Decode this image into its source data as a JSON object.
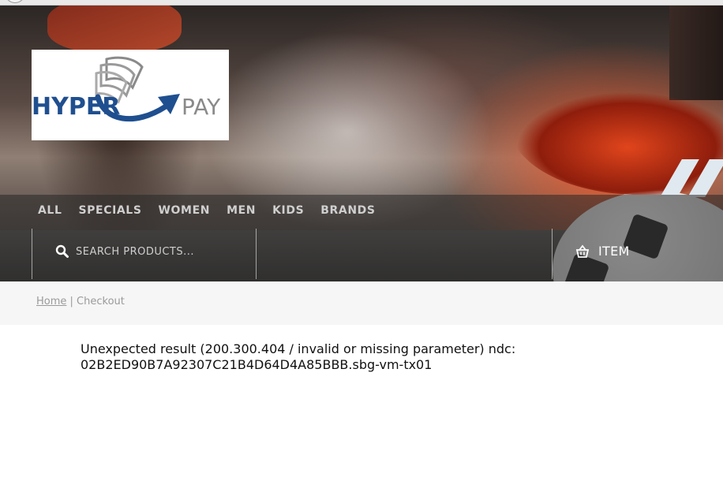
{
  "logo": {
    "text_left": "HYPER",
    "text_right": "PAY"
  },
  "nav": {
    "items": [
      "ALL",
      "SPECIALS",
      "WOMEN",
      "MEN",
      "KIDS",
      "BRANDS"
    ]
  },
  "search": {
    "placeholder": "SEARCH PRODUCTS...",
    "icon": "search-icon"
  },
  "cart": {
    "label": "ITEM",
    "icon": "basket-icon"
  },
  "breadcrumb": {
    "home": "Home",
    "separator": " | ",
    "current": "Checkout"
  },
  "message": {
    "line1": "Unexpected result (200.300.404 / invalid or missing parameter) ndc:",
    "line2": "02B2ED90B7A92307C21B4D64D4A85BBB.sbg-vm-tx01"
  },
  "colors": {
    "nav_text": "#cfcfcf",
    "logo_blue": "#1f4f8f",
    "logo_gray": "#8a8a8a"
  }
}
